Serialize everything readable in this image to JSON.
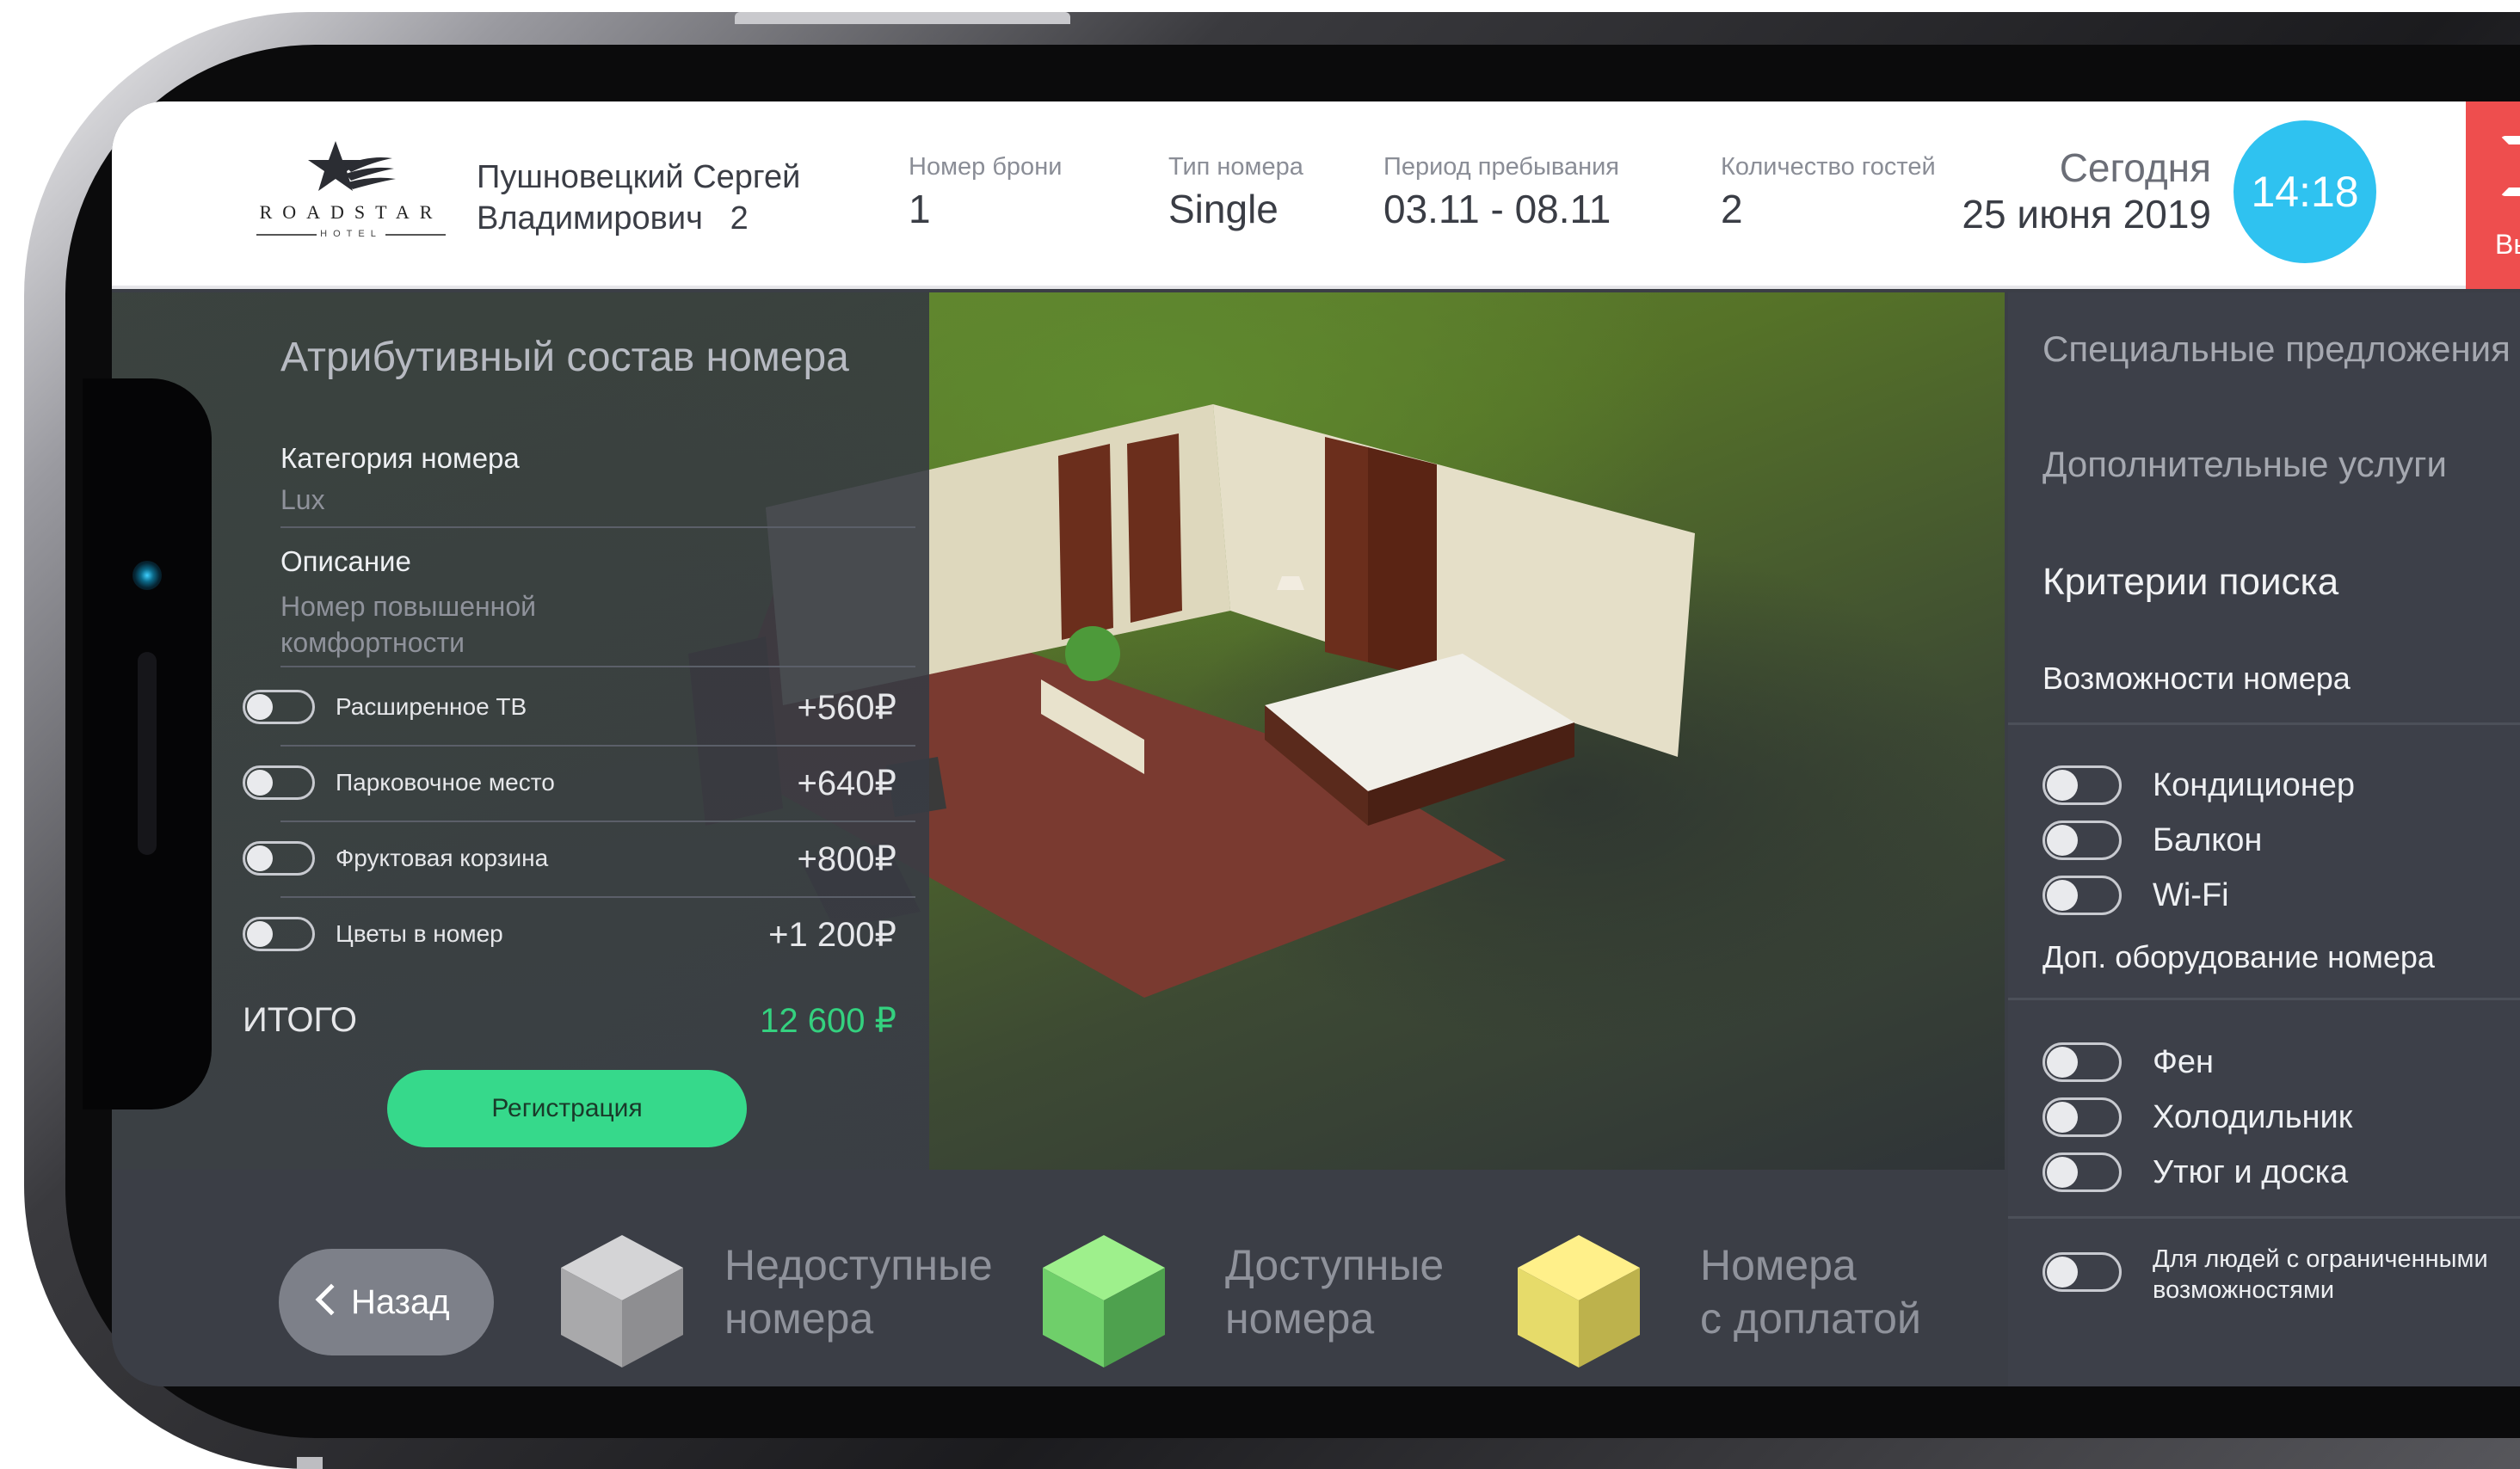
{
  "header": {
    "logo": {
      "brand": "ROADSTAR",
      "sub": "HOTEL"
    },
    "guest_name": "Пушновецкий Сергей",
    "guest_name_line2": "Владимирович",
    "guest_count_badge": "2",
    "booking_label": "Номер брони",
    "booking_value": "1",
    "room_type_label": "Тип номера",
    "room_type_value": "Single",
    "period_label": "Период пребывания",
    "period_value": "03.11 - 08.11",
    "guests_label": "Количество гостей",
    "guests_value": "2",
    "today_label": "Сегодня",
    "today_date": "25 июня 2019",
    "time": "14:18",
    "exit_label": "Вы"
  },
  "attributes": {
    "title": "Атрибутивный состав номера",
    "category_label": "Категория номера",
    "category_value": "Lux",
    "description_label": "Описание",
    "description_value_line1": "Номер повышенной",
    "description_value_line2": "комфортности",
    "options": [
      {
        "label": "Расширенное ТВ",
        "price": "+560₽",
        "enabled": false
      },
      {
        "label": "Парковочное место",
        "price": "+640₽",
        "enabled": false
      },
      {
        "label": "Фруктовая корзина",
        "price": "+800₽",
        "enabled": false
      },
      {
        "label": "Цветы в номер",
        "price": "+1 200₽",
        "enabled": false
      }
    ],
    "total_label": "ИТОГО",
    "total_value": "12 600 ₽",
    "register_label": "Регистрация"
  },
  "right_panel": {
    "special_offers": "Специальные предложения",
    "extra_services": "Дополнительные услуги",
    "search_criteria": "Критерии поиска",
    "room_features_title": "Возможности номера",
    "room_features": [
      {
        "label": "Кондиционер",
        "enabled": false
      },
      {
        "label": "Балкон",
        "enabled": false
      },
      {
        "label": "Wi-Fi",
        "enabled": false
      }
    ],
    "extra_equipment_title": "Доп. оборудование номера",
    "extra_equipment": [
      {
        "label": "Фен",
        "enabled": false
      },
      {
        "label": "Холодильник",
        "enabled": false
      },
      {
        "label": "Утюг и доска",
        "enabled": false
      }
    ],
    "accessibility_line1": "Для людей с ограниченными",
    "accessibility_line2": "возможностями",
    "accessibility_enabled": false
  },
  "legend": {
    "back_label": "Назад",
    "items": [
      {
        "line1": "Недоступные",
        "line2": "номера",
        "color": "#a9a9ab"
      },
      {
        "line1": "Доступные",
        "line2": "номера",
        "color": "#6fcf6a"
      },
      {
        "line1": "Номера",
        "line2": "с доплатой",
        "color": "#e6db6a"
      }
    ]
  },
  "colors": {
    "accent_green": "#36d98b",
    "clock_blue": "#2fc2f0",
    "exit_red": "#ee4e4e",
    "total_green": "#34d17f"
  }
}
